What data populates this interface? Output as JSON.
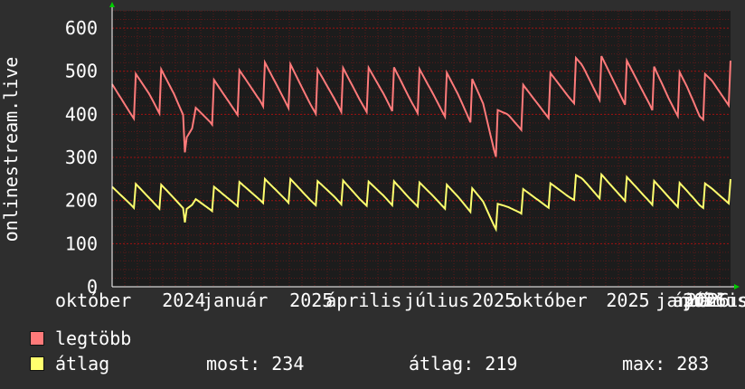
{
  "colors": {
    "background": "#2e2e2e",
    "plot_background": "#1c1c1c",
    "grid": "#8b0000",
    "axis_text": "#ffffff",
    "series_max": "#ff7a7a",
    "series_avg": "#ffff6e",
    "arrow": "#00cc00"
  },
  "chart_data": {
    "type": "line",
    "ylabel": "onlinestream.live",
    "ylim": [
      0,
      640
    ],
    "yticks": [
      "0",
      "100",
      "200",
      "300",
      "400",
      "500",
      "600"
    ],
    "xticks": [
      "október",
      "2024",
      "január",
      "2025",
      "április",
      "július",
      "2025",
      "október",
      "2025",
      "január",
      "2026",
      "április",
      "július",
      "2026"
    ],
    "xtick_positions": [
      0.0,
      0.116,
      0.199,
      0.322,
      0.407,
      0.525,
      0.617,
      0.707,
      0.834,
      0.932,
      0.958,
      0.968,
      0.975,
      0.99
    ],
    "series": [
      {
        "name": "legtöbb",
        "color": "#ff7a7a",
        "anchors": [
          [
            0,
            430
          ],
          [
            0.03,
            440
          ],
          [
            0.06,
            455
          ],
          [
            0.1,
            450
          ],
          [
            0.115,
            440
          ],
          [
            0.12,
            290
          ],
          [
            0.13,
            340
          ],
          [
            0.135,
            400
          ],
          [
            0.16,
            430
          ],
          [
            0.2,
            450
          ],
          [
            0.24,
            470
          ],
          [
            0.28,
            465
          ],
          [
            0.32,
            455
          ],
          [
            0.36,
            460
          ],
          [
            0.4,
            455
          ],
          [
            0.44,
            460
          ],
          [
            0.48,
            450
          ],
          [
            0.52,
            450
          ],
          [
            0.56,
            445
          ],
          [
            0.6,
            420
          ],
          [
            0.62,
            350
          ],
          [
            0.64,
            390
          ],
          [
            0.66,
            410
          ],
          [
            0.7,
            440
          ],
          [
            0.74,
            470
          ],
          [
            0.76,
            490
          ],
          [
            0.8,
            480
          ],
          [
            0.83,
            470
          ],
          [
            0.87,
            465
          ],
          [
            0.9,
            450
          ],
          [
            0.93,
            445
          ],
          [
            0.95,
            430
          ],
          [
            0.97,
            455
          ],
          [
            1.0,
            470
          ]
        ]
      },
      {
        "name": "átlag",
        "color": "#ffff6e",
        "anchors": [
          [
            0,
            210
          ],
          [
            0.03,
            212
          ],
          [
            0.06,
            210
          ],
          [
            0.1,
            207
          ],
          [
            0.115,
            205
          ],
          [
            0.12,
            150
          ],
          [
            0.13,
            175
          ],
          [
            0.135,
            195
          ],
          [
            0.16,
            205
          ],
          [
            0.2,
            215
          ],
          [
            0.24,
            222
          ],
          [
            0.28,
            222
          ],
          [
            0.32,
            218
          ],
          [
            0.36,
            222
          ],
          [
            0.4,
            215
          ],
          [
            0.44,
            218
          ],
          [
            0.48,
            212
          ],
          [
            0.52,
            212
          ],
          [
            0.56,
            208
          ],
          [
            0.6,
            195
          ],
          [
            0.62,
            160
          ],
          [
            0.64,
            180
          ],
          [
            0.66,
            195
          ],
          [
            0.7,
            210
          ],
          [
            0.74,
            225
          ],
          [
            0.76,
            238
          ],
          [
            0.8,
            230
          ],
          [
            0.83,
            225
          ],
          [
            0.87,
            220
          ],
          [
            0.9,
            215
          ],
          [
            0.93,
            212
          ],
          [
            0.95,
            208
          ],
          [
            0.97,
            215
          ],
          [
            1.0,
            220
          ]
        ]
      }
    ],
    "note_values": "anchors are [fraction of time span, value]; series are filled with deterministic noise around anchors",
    "stats": {
      "now": 234,
      "average": 219,
      "max": 283
    }
  },
  "legend": {
    "max_label": "legtöbb",
    "avg_label": "átlag"
  },
  "stats": {
    "now_text": "most: 234",
    "avg_text": "átlag: 219",
    "max_text": "max: 283"
  }
}
